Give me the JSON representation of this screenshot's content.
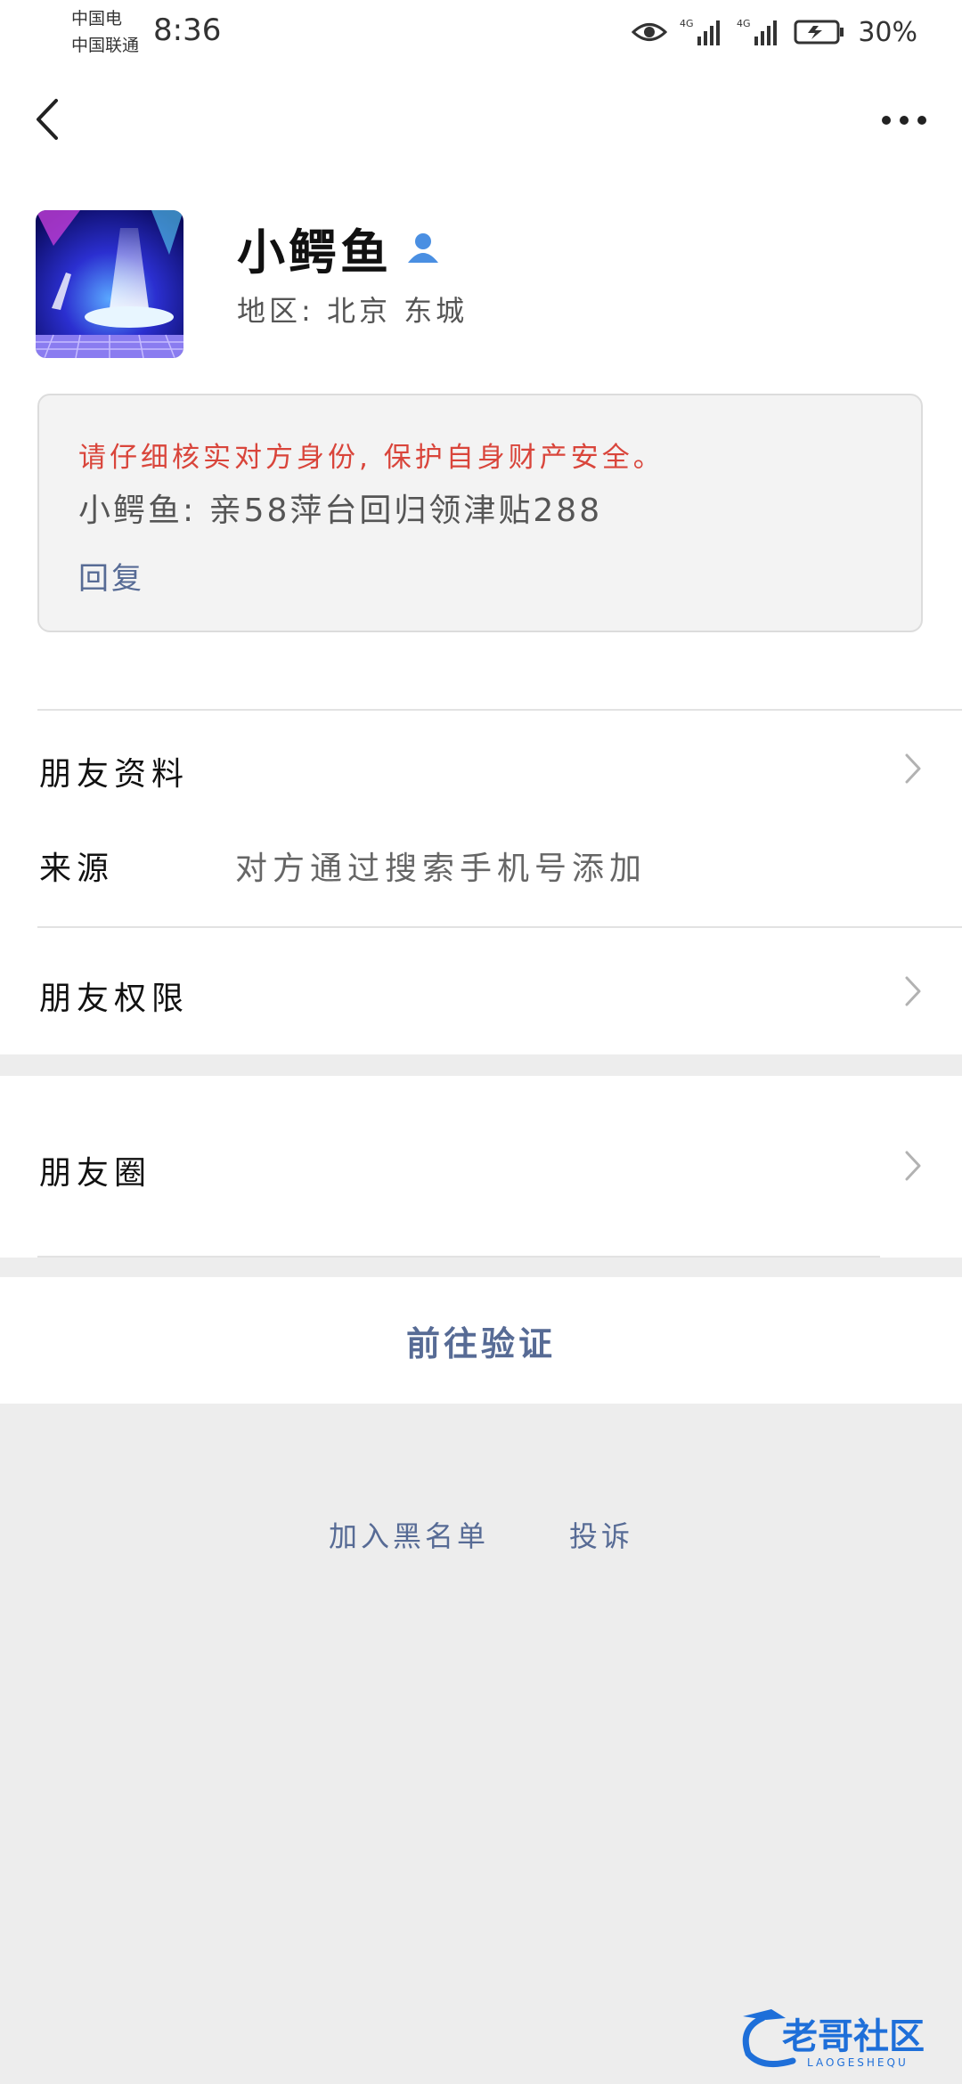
{
  "status_bar": {
    "carrier_1": "中国电",
    "carrier_2": "中国联通",
    "time": "8:36",
    "net_1": "4G",
    "net_2": "4G",
    "battery": "30%"
  },
  "nav": {
    "back_icon": "chevron-left-icon",
    "more_icon": "more-horizontal-icon"
  },
  "profile": {
    "nickname": "小鳄鱼",
    "region": "地区: 北京 东城",
    "warning": "请仔细核实对方身份, 保护自身财产安全。",
    "message": "小鳄鱼: 亲58萍台回归领津贴288",
    "reply": "回复"
  },
  "rows": {
    "friend_info": "朋友资料",
    "source_label": "来源",
    "source_value": "对方通过搜索手机号添加",
    "permissions": "朋友权限",
    "moments": "朋友圈"
  },
  "actions": {
    "verify": "前往验证",
    "blacklist": "加入黑名单",
    "report": "投诉"
  },
  "colors": {
    "link": "#576b95",
    "warning": "#d9453b",
    "background": "#ededed"
  },
  "watermark": {
    "text": "老哥社区",
    "sub": "LAOGESHEQU"
  }
}
